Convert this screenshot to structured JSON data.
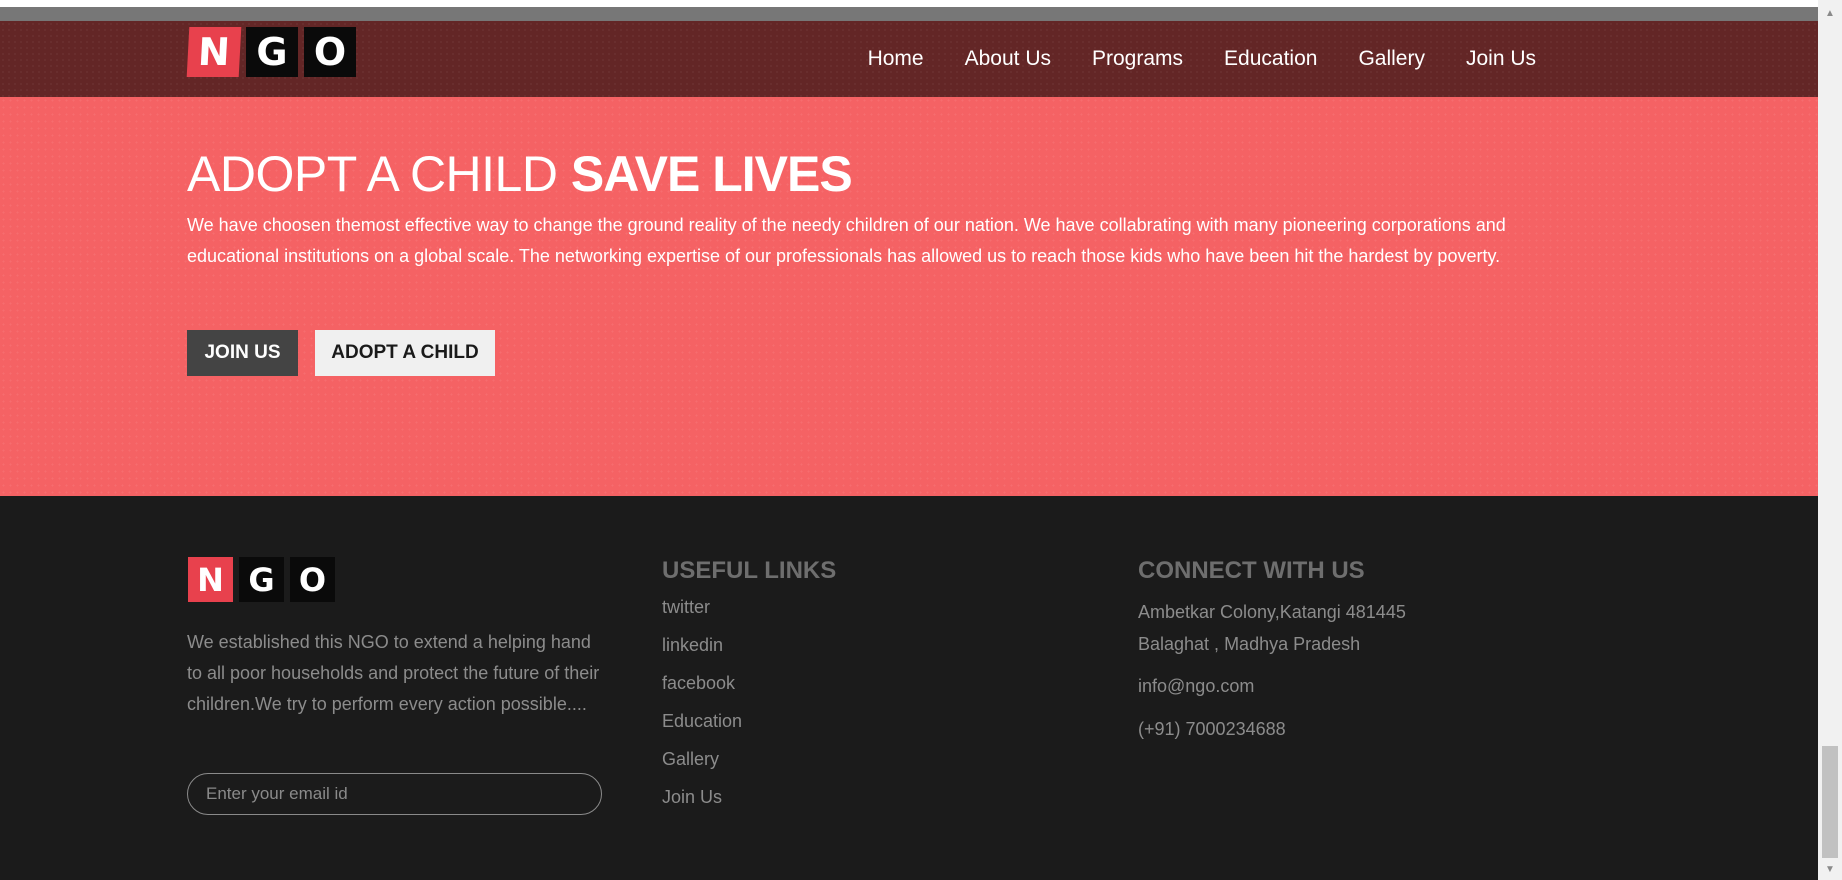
{
  "nav": {
    "logo_letters": [
      "N",
      "G",
      "O"
    ],
    "links": [
      "Home",
      "About Us",
      "Programs",
      "Education",
      "Gallery",
      "Join Us"
    ]
  },
  "hero": {
    "title_light": "ADOPT A CHILD ",
    "title_bold": "SAVE LIVES",
    "description": "We have choosen themost effective way to change the ground reality of the needy children of our nation. We have collabrating with many pioneering corporations and educational institutions on a global scale. The networking expertise of our professionals has allowed us to reach those kids who have been hit the hardest by poverty.",
    "join_label": "JOIN US",
    "adopt_label": "ADOPT A CHILD"
  },
  "footer": {
    "logo_letters": [
      "N",
      "G",
      "O"
    ],
    "about": "We established this NGO to extend a helping hand to all poor households and protect the future of their children.We try to perform every action possible....",
    "email_placeholder": "Enter your email id",
    "useful_links_heading": "USEFUL LINKS",
    "useful_links": [
      "twitter",
      "linkedin",
      "facebook",
      "Education",
      "Gallery",
      "Join Us"
    ],
    "connect_heading": "CONNECT WITH US",
    "address_line1": "Ambetkar Colony,Katangi 481445",
    "address_line2": "Balaghat , Madhya Pradesh",
    "email": "info@ngo.com",
    "phone": "(+91) 7000234688"
  },
  "colors": {
    "nav_bg": "#632626",
    "hero_bg": "#f56264",
    "footer_bg": "#1b1b1b",
    "logo_red": "#e8414d"
  },
  "icons": {
    "scroll_up": "triangle-up-icon",
    "scroll_down": "triangle-down-icon"
  }
}
